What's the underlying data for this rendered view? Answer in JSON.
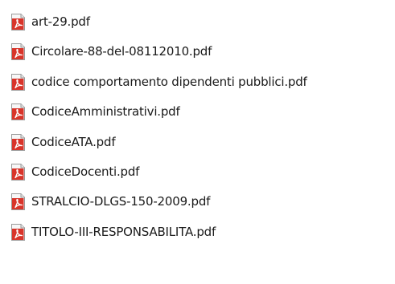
{
  "files": [
    {
      "name": "art-29.pdf",
      "icon": "pdf-file-icon"
    },
    {
      "name": "Circolare-88-del-08112010.pdf",
      "icon": "pdf-file-icon"
    },
    {
      "name": "codice comportamento dipendenti pubblici.pdf",
      "icon": "pdf-file-icon"
    },
    {
      "name": "CodiceAmministrativi.pdf",
      "icon": "pdf-file-icon"
    },
    {
      "name": "CodiceATA.pdf",
      "icon": "pdf-file-icon"
    },
    {
      "name": "CodiceDocenti.pdf",
      "icon": "pdf-file-icon"
    },
    {
      "name": "STRALCIO-DLGS-150-2009.pdf",
      "icon": "pdf-file-icon"
    },
    {
      "name": "TITOLO-III-RESPONSABILITA.pdf",
      "icon": "pdf-file-icon"
    }
  ],
  "colors": {
    "icon_red": "#d8342a",
    "icon_page": "#f6f6f6",
    "text": "#1a1a1a"
  }
}
